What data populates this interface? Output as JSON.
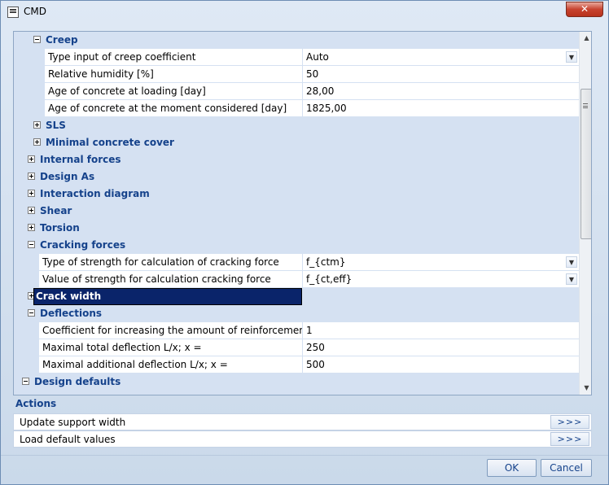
{
  "window": {
    "title": "CMD",
    "close_label": "✕"
  },
  "grid": {
    "rows": [
      {
        "type": "category",
        "label": "Creep",
        "expanded": true,
        "indent": 1
      },
      {
        "type": "property",
        "name": "Type input of creep coefficient",
        "value": "Auto",
        "dropdown": true,
        "indent": 1
      },
      {
        "type": "property",
        "name": "Relative humidity [%]",
        "value": "50",
        "dropdown": false,
        "indent": 1
      },
      {
        "type": "property",
        "name": "Age of concrete at loading [day]",
        "value": "28,00",
        "dropdown": false,
        "indent": 1
      },
      {
        "type": "property",
        "name": "Age of concrete at the moment considered [day]",
        "value": "1825,00",
        "dropdown": false,
        "indent": 1
      },
      {
        "type": "category",
        "label": "SLS",
        "expanded": false,
        "indent": 1
      },
      {
        "type": "category",
        "label": "Minimal concrete cover",
        "expanded": false,
        "indent": 1
      },
      {
        "type": "category",
        "label": "Internal forces",
        "expanded": false,
        "indent": 0
      },
      {
        "type": "category",
        "label": "Design As",
        "expanded": false,
        "indent": 0
      },
      {
        "type": "category",
        "label": "Interaction diagram",
        "expanded": false,
        "indent": 0
      },
      {
        "type": "category",
        "label": "Shear",
        "expanded": false,
        "indent": 0
      },
      {
        "type": "category",
        "label": "Torsion",
        "expanded": false,
        "indent": 0
      },
      {
        "type": "category",
        "label": "Cracking forces",
        "expanded": true,
        "indent": 0
      },
      {
        "type": "property",
        "name": "Type of strength for calculation of cracking force",
        "value": "f_{ctm}",
        "dropdown": true,
        "indent": 0
      },
      {
        "type": "property",
        "name": "Value of strength for calculation cracking force",
        "value": "f_{ct,eff}",
        "dropdown": true,
        "indent": 0
      },
      {
        "type": "category",
        "label": "Crack width",
        "expanded": false,
        "indent": 0,
        "selected": true
      },
      {
        "type": "category",
        "label": "Deflections",
        "expanded": true,
        "indent": 0
      },
      {
        "type": "property",
        "name": "Coefficient for increasing the amount of reinforcement",
        "value": "1",
        "dropdown": false,
        "indent": 0
      },
      {
        "type": "property",
        "name": "Maximal total deflection L/x; x =",
        "value": "250",
        "dropdown": false,
        "indent": 0
      },
      {
        "type": "property",
        "name": "Maximal additional deflection L/x; x =",
        "value": "500",
        "dropdown": false,
        "indent": 0
      },
      {
        "type": "category",
        "label": "Design defaults",
        "expanded": true,
        "indent": -1
      }
    ]
  },
  "actions": {
    "header": "Actions",
    "items": [
      {
        "label": "Update support width",
        "button": ">>>"
      },
      {
        "label": "Load default values",
        "button": ">>>"
      }
    ]
  },
  "buttons": {
    "ok": "OK",
    "cancel": "Cancel"
  },
  "colors": {
    "category_text": "#15428b",
    "selection": "#0a246a",
    "grid_background": "#d5e1f2"
  }
}
